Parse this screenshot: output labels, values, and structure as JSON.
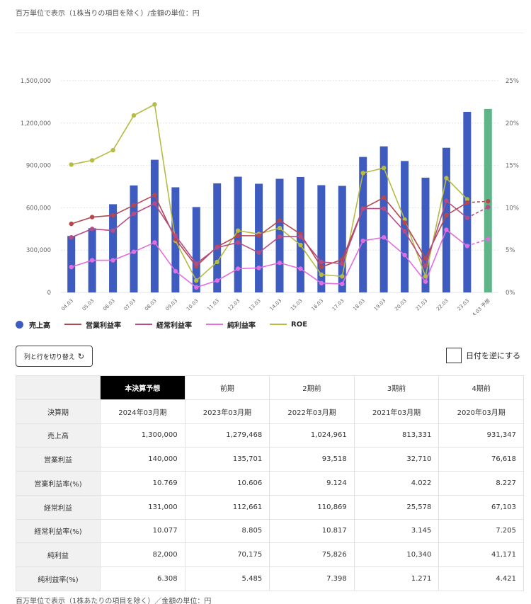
{
  "notes": {
    "top": "百万単位で表示（1株当りの項目を除く）/金額の単位：円",
    "bottom": "百万単位で表示（1株あたりの項目を除く）／金額の単位：円"
  },
  "legend": [
    {
      "label": "売上高",
      "type": "dot",
      "color": "#3e5bbf"
    },
    {
      "label": "営業利益率",
      "type": "line",
      "color": "#b5474f"
    },
    {
      "label": "経常利益率",
      "type": "line",
      "color": "#b54c86"
    },
    {
      "label": "純利益率",
      "type": "line",
      "color": "#e46de0"
    },
    {
      "label": "ROE",
      "type": "line",
      "color": "#b6bb43"
    }
  ],
  "controls": {
    "swap_label": "列と行を切り替え",
    "reverse_label": "日付を逆にする"
  },
  "chart_data": {
    "type": "bar",
    "categories": [
      "04.03",
      "05.03",
      "06.03",
      "07.03",
      "08.03",
      "09.03",
      "10.03",
      "11.03",
      "12.03",
      "13.03",
      "14.03",
      "15.03",
      "16.03",
      "17.03",
      "18.03",
      "19.03",
      "20.03",
      "21.03",
      "22.03",
      "23.03",
      "24.03 予想"
    ],
    "y_left": {
      "range": [
        0,
        1500000
      ],
      "ticks": [
        "0",
        "300,000",
        "600,000",
        "900,000",
        "1,200,000",
        "1,500,000"
      ]
    },
    "y_right": {
      "range": [
        0,
        25
      ],
      "ticks": [
        "0%",
        "5%",
        "10%",
        "15%",
        "20%",
        "25%"
      ]
    },
    "bars": {
      "name": "売上高",
      "color": "#3e5bbf",
      "forecast_color": "#5fb488",
      "values": [
        400000,
        455000,
        625000,
        758000,
        940000,
        745000,
        605000,
        773000,
        820000,
        770000,
        805000,
        818000,
        760000,
        755000,
        960000,
        1035000,
        931347,
        813331,
        1024961,
        1279468,
        1300000
      ]
    },
    "series": [
      {
        "name": "ROE",
        "color": "#b6bb43",
        "values": [
          15.1,
          15.6,
          16.8,
          20.9,
          22.2,
          6.1,
          1.4,
          3.6,
          7.3,
          6.9,
          7.6,
          5.6,
          2.1,
          1.9,
          14.1,
          14.7,
          8.6,
          1.9,
          13.5,
          11.0,
          null
        ]
      },
      {
        "name": "営業利益率",
        "color": "#b5474f",
        "values": [
          8.1,
          8.9,
          9.1,
          10.3,
          11.5,
          6.3,
          3.1,
          5.4,
          6.7,
          6.7,
          8.5,
          6.9,
          3.0,
          3.9,
          9.9,
          11.2,
          8.227,
          4.022,
          9.124,
          10.606,
          10.769
        ]
      },
      {
        "name": "経常利益率",
        "color": "#b54c86",
        "values": [
          6.5,
          7.5,
          7.3,
          9.3,
          10.5,
          6.7,
          3.4,
          5.3,
          5.9,
          4.7,
          6.6,
          6.6,
          3.6,
          3.4,
          9.9,
          9.9,
          7.205,
          3.145,
          10.817,
          8.805,
          10.077
        ]
      },
      {
        "name": "純利益率",
        "color": "#e46de0",
        "values": [
          3.0,
          3.8,
          3.8,
          4.8,
          5.9,
          2.5,
          0.6,
          1.4,
          2.8,
          2.9,
          3.5,
          2.8,
          1.1,
          1.0,
          6.1,
          6.5,
          4.421,
          1.271,
          7.398,
          5.485,
          6.308
        ]
      }
    ]
  },
  "table": {
    "columns": [
      "本決算予想",
      "前期",
      "2期前",
      "3期前",
      "4期前"
    ],
    "rows": [
      {
        "label": "決算期",
        "values": [
          "2024年03月期",
          "2023年03月期",
          "2022年03月期",
          "2021年03月期",
          "2020年03月期"
        ],
        "align": "center"
      },
      {
        "label": "売上高",
        "values": [
          "1,300,000",
          "1,279,468",
          "1,024,961",
          "813,331",
          "931,347"
        ]
      },
      {
        "label": "営業利益",
        "values": [
          "140,000",
          "135,701",
          "93,518",
          "32,710",
          "76,618"
        ]
      },
      {
        "label": "営業利益率(%)",
        "values": [
          "10.769",
          "10.606",
          "9.124",
          "4.022",
          "8.227"
        ]
      },
      {
        "label": "経常利益",
        "values": [
          "131,000",
          "112,661",
          "110,869",
          "25,578",
          "67,103"
        ]
      },
      {
        "label": "経常利益率(%)",
        "values": [
          "10.077",
          "8.805",
          "10.817",
          "3.145",
          "7.205"
        ]
      },
      {
        "label": "純利益",
        "values": [
          "82,000",
          "70,175",
          "75,826",
          "10,340",
          "41,171"
        ]
      },
      {
        "label": "純利益率(%)",
        "values": [
          "6.308",
          "5.485",
          "7.398",
          "1.271",
          "4.421"
        ]
      }
    ]
  }
}
